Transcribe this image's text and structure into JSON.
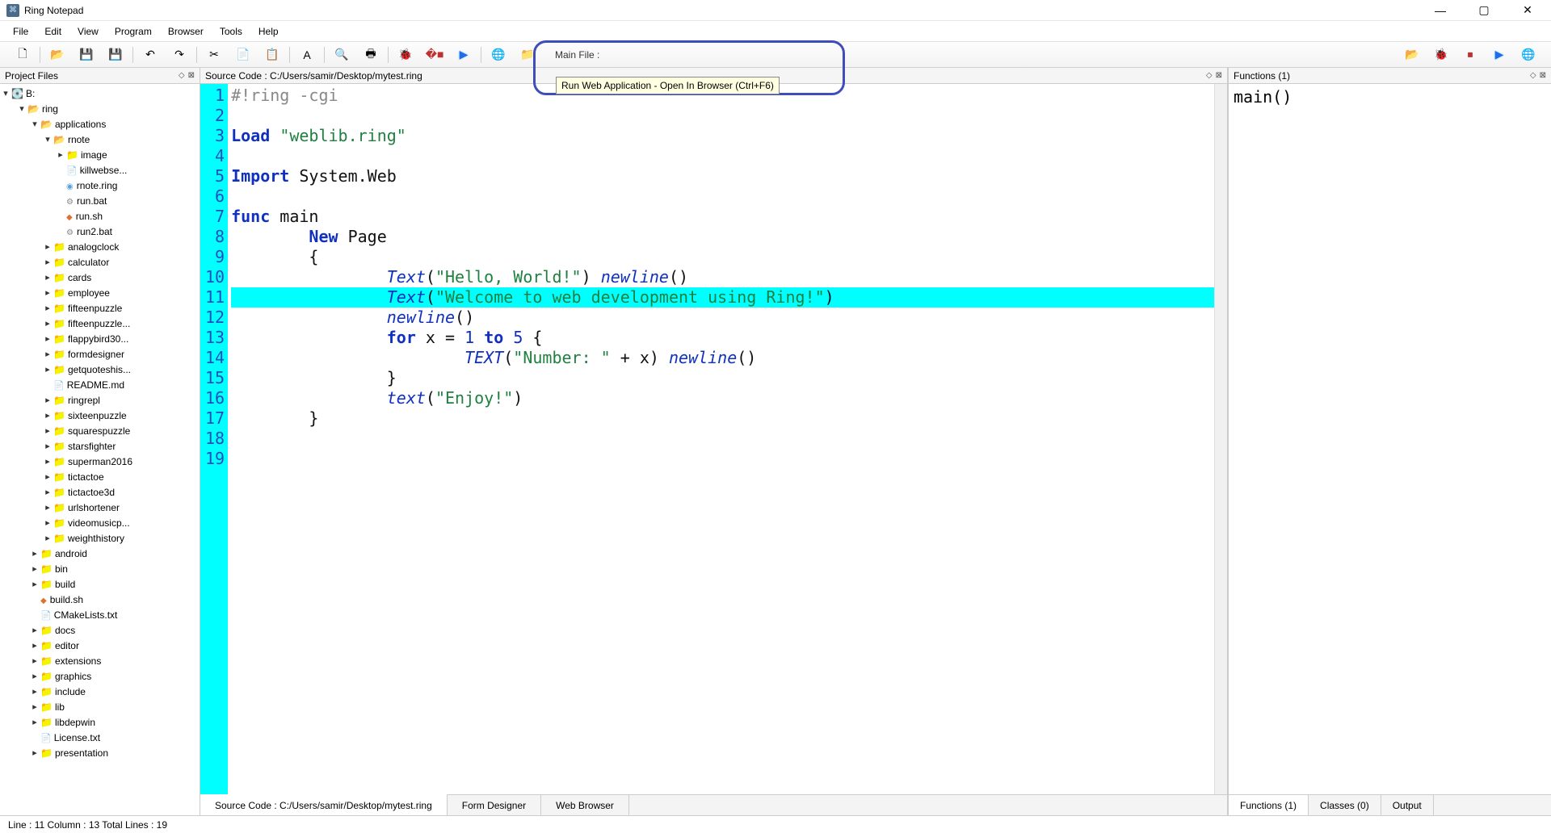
{
  "app": {
    "title": "Ring Notepad"
  },
  "window_controls": {
    "min": "—",
    "max": "▢",
    "close": "✕"
  },
  "menubar": [
    "File",
    "Edit",
    "View",
    "Program",
    "Browser",
    "Tools",
    "Help"
  ],
  "toolbar": {
    "buttons_left": [
      {
        "name": "new-file-icon",
        "glyph": "🗋"
      },
      {
        "name": "open-file-icon",
        "glyph": "📂"
      },
      {
        "name": "save-icon",
        "glyph": "💾"
      },
      {
        "name": "save-as-icon",
        "glyph": "💾"
      },
      {
        "name": "undo-icon",
        "glyph": "↶"
      },
      {
        "name": "redo-icon",
        "glyph": "↷"
      },
      {
        "name": "cut-icon",
        "glyph": "✂"
      },
      {
        "name": "copy-icon",
        "glyph": "📄"
      },
      {
        "name": "paste-icon",
        "glyph": "📋"
      },
      {
        "name": "font-icon",
        "glyph": "A"
      },
      {
        "name": "find-icon",
        "glyph": "🔍"
      },
      {
        "name": "print-icon",
        "glyph": "🖶"
      },
      {
        "name": "debug-icon",
        "glyph": "🐞"
      },
      {
        "name": "stop-icon",
        "glyph": "�■"
      },
      {
        "name": "run-icon",
        "glyph": "▶"
      },
      {
        "name": "run-web-icon",
        "glyph": "🌐"
      },
      {
        "name": "browse-folder-icon",
        "glyph": "📁"
      }
    ],
    "mainfile_label": "Main File :",
    "buttons_right": [
      {
        "name": "open-mainfile-icon",
        "glyph": "📂"
      },
      {
        "name": "debug-right-icon",
        "glyph": "🐞"
      },
      {
        "name": "stop-right-icon",
        "glyph": "⏹"
      },
      {
        "name": "run-right-icon",
        "glyph": "▶"
      },
      {
        "name": "run-web-right-icon",
        "glyph": "🌐"
      }
    ]
  },
  "tooltip": "Run Web Application - Open In Browser (Ctrl+F6)",
  "project": {
    "title": "Project Files",
    "drive": "B:",
    "tree": [
      {
        "d": 1,
        "t": "ring",
        "k": "fopen",
        "exp": true
      },
      {
        "d": 2,
        "t": "applications",
        "k": "fopen",
        "exp": true
      },
      {
        "d": 3,
        "t": "rnote",
        "k": "fopen",
        "exp": true
      },
      {
        "d": 4,
        "t": "image",
        "k": "folder",
        "exp": false,
        "arrow": true
      },
      {
        "d": 4,
        "t": "killwebse...",
        "k": "file"
      },
      {
        "d": 4,
        "t": "rnote.ring",
        "k": "ring"
      },
      {
        "d": 4,
        "t": "run.bat",
        "k": "bat"
      },
      {
        "d": 4,
        "t": "run.sh",
        "k": "sh"
      },
      {
        "d": 4,
        "t": "run2.bat",
        "k": "bat"
      },
      {
        "d": 3,
        "t": "analogclock",
        "k": "folder",
        "arrow": true
      },
      {
        "d": 3,
        "t": "calculator",
        "k": "folder",
        "arrow": true
      },
      {
        "d": 3,
        "t": "cards",
        "k": "folder",
        "arrow": true
      },
      {
        "d": 3,
        "t": "employee",
        "k": "folder",
        "arrow": true
      },
      {
        "d": 3,
        "t": "fifteenpuzzle",
        "k": "folder",
        "arrow": true
      },
      {
        "d": 3,
        "t": "fifteenpuzzle...",
        "k": "folder",
        "arrow": true
      },
      {
        "d": 3,
        "t": "flappybird30...",
        "k": "folder",
        "arrow": true
      },
      {
        "d": 3,
        "t": "formdesigner",
        "k": "folder",
        "arrow": true
      },
      {
        "d": 3,
        "t": "getquoteshis...",
        "k": "folder",
        "arrow": true
      },
      {
        "d": 3,
        "t": "README.md",
        "k": "file"
      },
      {
        "d": 3,
        "t": "ringrepl",
        "k": "folder",
        "arrow": true
      },
      {
        "d": 3,
        "t": "sixteenpuzzle",
        "k": "folder",
        "arrow": true
      },
      {
        "d": 3,
        "t": "squarespuzzle",
        "k": "folder",
        "arrow": true
      },
      {
        "d": 3,
        "t": "starsfighter",
        "k": "folder",
        "arrow": true
      },
      {
        "d": 3,
        "t": "superman2016",
        "k": "folder",
        "arrow": true
      },
      {
        "d": 3,
        "t": "tictactoe",
        "k": "folder",
        "arrow": true
      },
      {
        "d": 3,
        "t": "tictactoe3d",
        "k": "folder",
        "arrow": true
      },
      {
        "d": 3,
        "t": "urlshortener",
        "k": "folder",
        "arrow": true
      },
      {
        "d": 3,
        "t": "videomusicp...",
        "k": "folder",
        "arrow": true
      },
      {
        "d": 3,
        "t": "weighthistory",
        "k": "folder",
        "arrow": true
      },
      {
        "d": 2,
        "t": "android",
        "k": "folder",
        "arrow": true
      },
      {
        "d": 2,
        "t": "bin",
        "k": "folder",
        "arrow": true
      },
      {
        "d": 2,
        "t": "build",
        "k": "folder",
        "arrow": true
      },
      {
        "d": 2,
        "t": "build.sh",
        "k": "sh"
      },
      {
        "d": 2,
        "t": "CMakeLists.txt",
        "k": "file"
      },
      {
        "d": 2,
        "t": "docs",
        "k": "folder",
        "arrow": true
      },
      {
        "d": 2,
        "t": "editor",
        "k": "folder",
        "arrow": true
      },
      {
        "d": 2,
        "t": "extensions",
        "k": "folder",
        "arrow": true
      },
      {
        "d": 2,
        "t": "graphics",
        "k": "folder",
        "arrow": true
      },
      {
        "d": 2,
        "t": "include",
        "k": "folder",
        "arrow": true
      },
      {
        "d": 2,
        "t": "lib",
        "k": "folder",
        "arrow": true
      },
      {
        "d": 2,
        "t": "libdepwin",
        "k": "folder",
        "arrow": true
      },
      {
        "d": 2,
        "t": "License.txt",
        "k": "file"
      },
      {
        "d": 2,
        "t": "presentation",
        "k": "folder",
        "arrow": true
      }
    ]
  },
  "editor": {
    "header": "Source Code : C:/Users/samir/Desktop/mytest.ring",
    "highlight_line": 11,
    "lines": [
      [
        {
          "c": "cmt",
          "t": "#!ring -cgi"
        }
      ],
      [],
      [
        {
          "c": "kw",
          "t": "Load"
        },
        {
          "c": "plain",
          "t": " "
        },
        {
          "c": "str",
          "t": "\"weblib.ring\""
        }
      ],
      [],
      [
        {
          "c": "kw",
          "t": "Import"
        },
        {
          "c": "plain",
          "t": " System.Web"
        }
      ],
      [],
      [
        {
          "c": "kw",
          "t": "func"
        },
        {
          "c": "plain",
          "t": " main"
        }
      ],
      [
        {
          "c": "plain",
          "t": "        "
        },
        {
          "c": "kw",
          "t": "New"
        },
        {
          "c": "plain",
          "t": " Page"
        }
      ],
      [
        {
          "c": "plain",
          "t": "        {"
        }
      ],
      [
        {
          "c": "plain",
          "t": "                "
        },
        {
          "c": "fn-it",
          "t": "Text"
        },
        {
          "c": "plain",
          "t": "("
        },
        {
          "c": "str",
          "t": "\"Hello, World!\""
        },
        {
          "c": "plain",
          "t": ") "
        },
        {
          "c": "fn-it",
          "t": "newline"
        },
        {
          "c": "plain",
          "t": "()"
        }
      ],
      [
        {
          "c": "plain",
          "t": "                "
        },
        {
          "c": "fn-it",
          "t": "Text"
        },
        {
          "c": "plain",
          "t": "("
        },
        {
          "c": "str",
          "t": "\"Welcome to web development using Ring!\""
        },
        {
          "c": "plain",
          "t": ")"
        }
      ],
      [
        {
          "c": "plain",
          "t": "                "
        },
        {
          "c": "fn-it",
          "t": "newline"
        },
        {
          "c": "plain",
          "t": "()"
        }
      ],
      [
        {
          "c": "plain",
          "t": "                "
        },
        {
          "c": "kw",
          "t": "for"
        },
        {
          "c": "plain",
          "t": " x = "
        },
        {
          "c": "num",
          "t": "1"
        },
        {
          "c": "plain",
          "t": " "
        },
        {
          "c": "kw",
          "t": "to"
        },
        {
          "c": "plain",
          "t": " "
        },
        {
          "c": "num",
          "t": "5"
        },
        {
          "c": "plain",
          "t": " {"
        }
      ],
      [
        {
          "c": "plain",
          "t": "                        "
        },
        {
          "c": "fn-it",
          "t": "TEXT"
        },
        {
          "c": "plain",
          "t": "("
        },
        {
          "c": "str",
          "t": "\"Number: \""
        },
        {
          "c": "plain",
          "t": " + x) "
        },
        {
          "c": "fn-it",
          "t": "newline"
        },
        {
          "c": "plain",
          "t": "()"
        }
      ],
      [
        {
          "c": "plain",
          "t": "                }"
        }
      ],
      [
        {
          "c": "plain",
          "t": "                "
        },
        {
          "c": "fn-it",
          "t": "text"
        },
        {
          "c": "plain",
          "t": "("
        },
        {
          "c": "str",
          "t": "\"Enjoy!\""
        },
        {
          "c": "plain",
          "t": ")"
        }
      ],
      [
        {
          "c": "plain",
          "t": "        }"
        }
      ],
      [],
      []
    ],
    "tabs": [
      {
        "label": "Source Code : C:/Users/samir/Desktop/mytest.ring",
        "active": true
      },
      {
        "label": "Form Designer",
        "active": false
      },
      {
        "label": "Web Browser",
        "active": false
      }
    ]
  },
  "functions": {
    "header": "Functions (1)",
    "items": [
      "main()"
    ],
    "tabs": [
      {
        "label": "Functions (1)",
        "active": true
      },
      {
        "label": "Classes (0)",
        "active": false
      },
      {
        "label": "Output",
        "active": false
      }
    ]
  },
  "status": "Line : 11 Column : 13 Total Lines : 19"
}
